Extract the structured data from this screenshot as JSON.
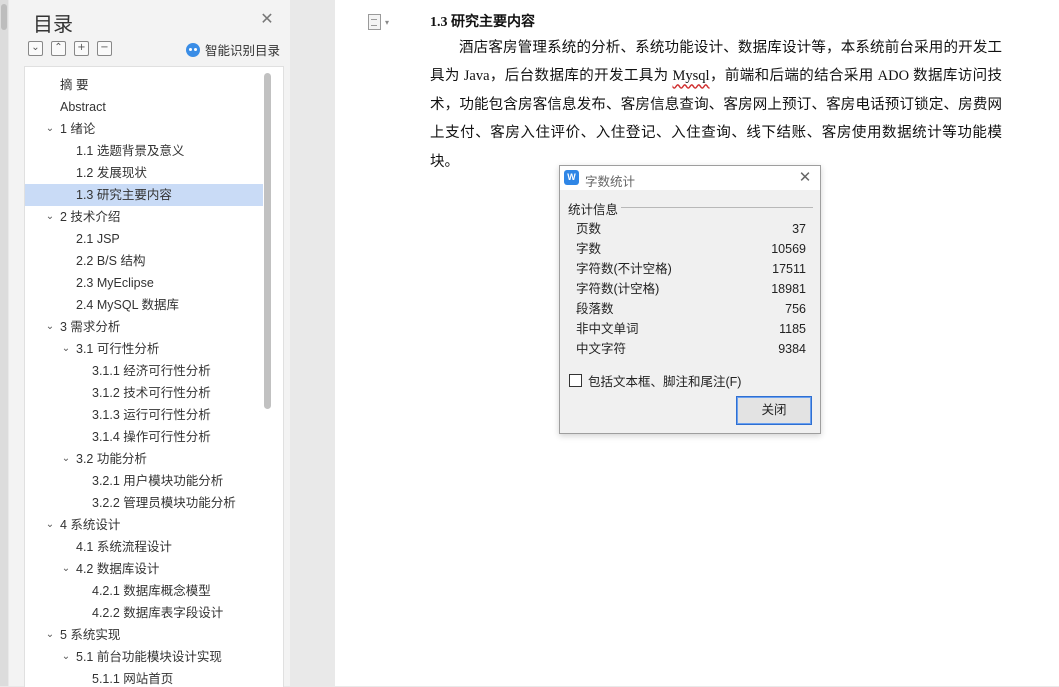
{
  "toc": {
    "title": "目录",
    "close_icon": "close-icon",
    "tools": [
      {
        "icon": "collapse-all-icon",
        "glyph": "⌄"
      },
      {
        "icon": "expand-up-icon",
        "glyph": "⌃"
      },
      {
        "icon": "add-icon",
        "glyph": "+"
      },
      {
        "icon": "remove-icon",
        "glyph": "−"
      }
    ],
    "smart_label": "智能识别目录",
    "items": [
      {
        "label": "摘  要",
        "level": 1,
        "chevron": false
      },
      {
        "label": "Abstract",
        "level": 1,
        "chevron": false
      },
      {
        "label": "1 绪论",
        "level": 1,
        "chevron": true
      },
      {
        "label": "1.1 选题背景及意义",
        "level": 2,
        "chevron": false
      },
      {
        "label": "1.2 发展现状",
        "level": 2,
        "chevron": false
      },
      {
        "label": "1.3 研究主要内容",
        "level": 2,
        "chevron": false,
        "active": true
      },
      {
        "label": "2 技术介绍",
        "level": 1,
        "chevron": true
      },
      {
        "label": "2.1 JSP",
        "level": 2,
        "chevron": false
      },
      {
        "label": "2.2 B/S 结构",
        "level": 2,
        "chevron": false
      },
      {
        "label": "2.3 MyEclipse",
        "level": 2,
        "chevron": false
      },
      {
        "label": "2.4 MySQL 数据库",
        "level": 2,
        "chevron": false
      },
      {
        "label": "3 需求分析",
        "level": 1,
        "chevron": true
      },
      {
        "label": "3.1 可行性分析",
        "level": 2,
        "chevron": true
      },
      {
        "label": "3.1.1  经济可行性分析",
        "level": 3,
        "chevron": false
      },
      {
        "label": "3.1.2  技术可行性分析",
        "level": 3,
        "chevron": false
      },
      {
        "label": "3.1.3  运行可行性分析",
        "level": 3,
        "chevron": false
      },
      {
        "label": "3.1.4  操作可行性分析",
        "level": 3,
        "chevron": false
      },
      {
        "label": "3.2 功能分析",
        "level": 2,
        "chevron": true
      },
      {
        "label": "3.2.1  用户模块功能分析",
        "level": 3,
        "chevron": false
      },
      {
        "label": "3.2.2  管理员模块功能分析",
        "level": 3,
        "chevron": false
      },
      {
        "label": "4 系统设计",
        "level": 1,
        "chevron": true
      },
      {
        "label": "4.1 系统流程设计",
        "level": 2,
        "chevron": false
      },
      {
        "label": "4.2 数据库设计",
        "level": 2,
        "chevron": true
      },
      {
        "label": "4.2.1  数据库概念模型",
        "level": 3,
        "chevron": false
      },
      {
        "label": "4.2.2  数据库表字段设计",
        "level": 3,
        "chevron": false
      },
      {
        "label": "5 系统实现",
        "level": 1,
        "chevron": true
      },
      {
        "label": "5.1  前台功能模块设计实现",
        "level": 2,
        "chevron": true
      },
      {
        "label": "5.1.1 网站首页",
        "level": 3,
        "chevron": false
      }
    ]
  },
  "document": {
    "heading": "1.3 研究主要内容",
    "para_before": "酒店客房管理系统的分析、系统功能设计、数据库设计等，本系统前台采用的开发工具为 Java，后台数据库的开发工具为 ",
    "para_mysql": "Mysql",
    "para_after": "，前端和后端的结合采用 ADO 数据库访问技术，功能包含房客信息发布、客房信息查询、客房网上预订、客房电话预订锁定、房费网上支付、客房入住评价、入住登记、入住查询、线下结账、客房使用数据统计等功能模块。"
  },
  "dialog": {
    "title": "字数统计",
    "app_icon": "wps-writer-icon",
    "group_label": "统计信息",
    "stats": [
      {
        "label": "页数",
        "value": "37"
      },
      {
        "label": "字数",
        "value": "10569"
      },
      {
        "label": "字符数(不计空格)",
        "value": "17511"
      },
      {
        "label": "字符数(计空格)",
        "value": "18981"
      },
      {
        "label": "段落数",
        "value": "756"
      },
      {
        "label": "非中文单词",
        "value": "1185"
      },
      {
        "label": "中文字符",
        "value": "9384"
      }
    ],
    "checkbox_label": "包括文本框、脚注和尾注(F)",
    "checkbox_checked": false,
    "close_button": "关闭"
  }
}
